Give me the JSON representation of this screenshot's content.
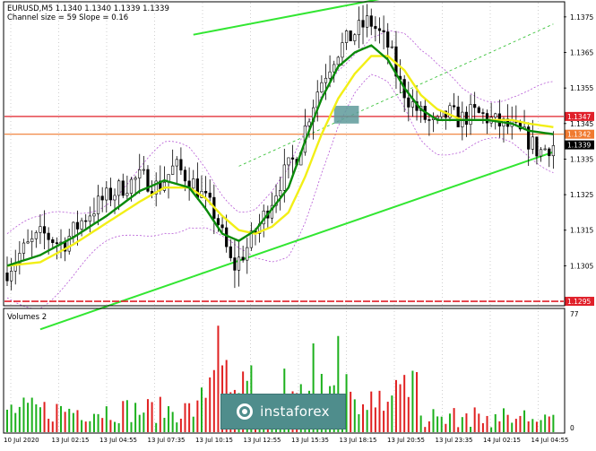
{
  "header": {
    "symbol_line": "EURUSD,M5 1.1340 1.1340 1.1339 1.1339",
    "channel_line": "Channel size = 59 Slope = 0.16",
    "volume_label": "Volumes 2"
  },
  "logo": {
    "text": "instaforex"
  },
  "colors": {
    "background": "#ffffff",
    "candle": "#000000",
    "ma_fast": "#0a8a0a",
    "ma_slow": "#f2ef16",
    "channel": "#32e632",
    "envelope": "#b75bd6",
    "level_red": "#e0202a",
    "level_orange": "#f07a30",
    "volume_up": "#1cb01c",
    "volume_down": "#e02020",
    "grid": "#b0b0b0",
    "box": "#5e9a9a"
  },
  "chart_data": {
    "type": "candlestick",
    "symbol": "EURUSD",
    "timeframe": "M5",
    "ohlc_header": {
      "open": 1.134,
      "high": 1.134,
      "low": 1.1339,
      "close": 1.1339
    },
    "channel": {
      "size": 59,
      "slope": 0.16
    },
    "ylim": [
      1.1294,
      1.1379
    ],
    "y_ticks": [
      "1.1375",
      "1.1365",
      "1.1355",
      "1.1345",
      "1.1335",
      "1.1325",
      "1.1315",
      "1.1305"
    ],
    "x_labels": [
      "10 Jul 2020",
      "13 Jul 02:15",
      "13 Jul 04:55",
      "13 Jul 07:35",
      "13 Jul 10:15",
      "13 Jul 12:55",
      "13 Jul 15:35",
      "13 Jul 18:15",
      "13 Jul 20:55",
      "13 Jul 23:35",
      "14 Jul 02:15",
      "14 Jul 04:55"
    ],
    "price_path": [
      [
        0,
        1.1303
      ],
      [
        4,
        1.1309
      ],
      [
        9,
        1.1314
      ],
      [
        14,
        1.1311
      ],
      [
        18,
        1.1317
      ],
      [
        23,
        1.1323
      ],
      [
        28,
        1.1327
      ],
      [
        33,
        1.133
      ],
      [
        37,
        1.1327
      ],
      [
        41,
        1.1333
      ],
      [
        45,
        1.1329
      ],
      [
        48,
        1.1324
      ],
      [
        51,
        1.1319
      ],
      [
        55,
        1.1304
      ],
      [
        59,
        1.1311
      ],
      [
        63,
        1.132
      ],
      [
        67,
        1.133
      ],
      [
        71,
        1.1337
      ],
      [
        73,
        1.1346
      ],
      [
        76,
        1.1356
      ],
      [
        80,
        1.1365
      ],
      [
        84,
        1.137
      ],
      [
        88,
        1.1374
      ],
      [
        90,
        1.1371
      ],
      [
        93,
        1.1366
      ],
      [
        95,
        1.1357
      ],
      [
        98,
        1.1351
      ],
      [
        101,
        1.1347
      ],
      [
        104,
        1.1344
      ],
      [
        107,
        1.1348
      ],
      [
        110,
        1.1346
      ],
      [
        113,
        1.1348
      ],
      [
        116,
        1.1347
      ],
      [
        119,
        1.1345
      ],
      [
        122,
        1.1344
      ],
      [
        126,
        1.1341
      ],
      [
        129,
        1.1337
      ],
      [
        132,
        1.1339
      ]
    ],
    "ma_fast_path": [
      [
        0,
        1.1305
      ],
      [
        8,
        1.1308
      ],
      [
        16,
        1.1313
      ],
      [
        24,
        1.1319
      ],
      [
        32,
        1.1326
      ],
      [
        38,
        1.1329
      ],
      [
        44,
        1.1327
      ],
      [
        48,
        1.1321
      ],
      [
        52,
        1.1314
      ],
      [
        56,
        1.1312
      ],
      [
        60,
        1.1315
      ],
      [
        64,
        1.1321
      ],
      [
        68,
        1.1327
      ],
      [
        72,
        1.134
      ],
      [
        76,
        1.1352
      ],
      [
        80,
        1.1361
      ],
      [
        84,
        1.1365
      ],
      [
        88,
        1.1367
      ],
      [
        92,
        1.1363
      ],
      [
        96,
        1.1355
      ],
      [
        100,
        1.1349
      ],
      [
        104,
        1.1346
      ],
      [
        110,
        1.1346
      ],
      [
        116,
        1.1346
      ],
      [
        122,
        1.1345
      ],
      [
        126,
        1.1343
      ],
      [
        132,
        1.1342
      ]
    ],
    "ma_slow_path": [
      [
        0,
        1.1305
      ],
      [
        8,
        1.1306
      ],
      [
        16,
        1.1311
      ],
      [
        24,
        1.1317
      ],
      [
        32,
        1.1323
      ],
      [
        38,
        1.1327
      ],
      [
        44,
        1.1327
      ],
      [
        48,
        1.1324
      ],
      [
        52,
        1.1319
      ],
      [
        56,
        1.1315
      ],
      [
        60,
        1.1314
      ],
      [
        64,
        1.1316
      ],
      [
        68,
        1.132
      ],
      [
        72,
        1.133
      ],
      [
        76,
        1.1342
      ],
      [
        80,
        1.1352
      ],
      [
        84,
        1.1359
      ],
      [
        88,
        1.1364
      ],
      [
        92,
        1.1364
      ],
      [
        96,
        1.136
      ],
      [
        100,
        1.1353
      ],
      [
        104,
        1.1349
      ],
      [
        110,
        1.1346
      ],
      [
        116,
        1.1346
      ],
      [
        122,
        1.1346
      ],
      [
        126,
        1.1345
      ],
      [
        132,
        1.1344
      ]
    ],
    "upper_channel": [
      [
        45,
        1.137
      ],
      [
        90,
        1.138
      ]
    ],
    "lower_channel": [
      [
        45,
        1.1302
      ],
      [
        132,
        1.1337
      ]
    ],
    "upper_channel_dotted": [
      [
        56,
        1.1333
      ],
      [
        132,
        1.1373
      ]
    ],
    "levels": [
      {
        "price": 1.1347,
        "label": "1.1347",
        "color": "#e0202a",
        "style": "solid"
      },
      {
        "price": 1.1342,
        "label": "1.1342",
        "color": "#f07a30",
        "style": "solid"
      },
      {
        "price": 1.1339,
        "label": "1.1339",
        "color": "#000000",
        "style": "current"
      },
      {
        "price": 1.1295,
        "label": "1.1295",
        "color": "#e0202a",
        "style": "dashed"
      }
    ],
    "highlight_box": {
      "x": [
        79,
        85
      ],
      "y": [
        1.1345,
        1.135
      ]
    },
    "volume_panel": {
      "title": "Volumes 2",
      "ymax": 77,
      "ticks": [
        "77",
        "0"
      ]
    }
  }
}
